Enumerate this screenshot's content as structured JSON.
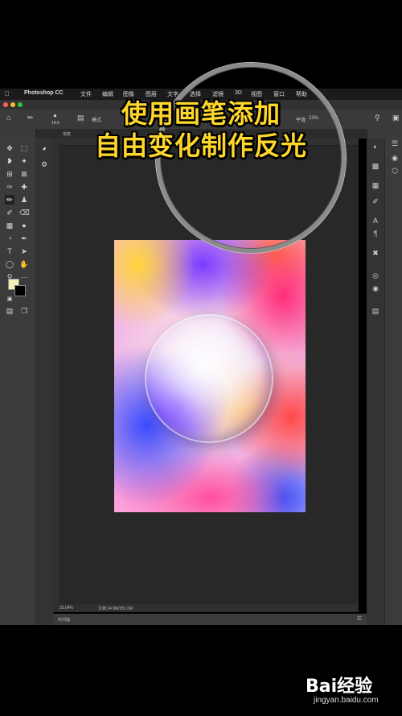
{
  "menubar": {
    "app_name": "Photoshop CC",
    "items": [
      "文件",
      "编辑",
      "图像",
      "图层",
      "文字",
      "选择",
      "滤镜",
      "3D",
      "视图",
      "窗口",
      "帮助"
    ]
  },
  "options_bar": {
    "brush_size": "19.0",
    "mode_label": "模式",
    "smoothing_label": "平滑:",
    "smoothing_value": "23%"
  },
  "doc_tab": {
    "label": "渐变"
  },
  "caption": {
    "line1": "使用画笔添加",
    "line2": "自由变化制作反光"
  },
  "status_bar": {
    "zoom": "33.04%",
    "doc_info": "文档:24.9M/351.0M"
  },
  "timeline": {
    "label": "时间轴"
  },
  "watermark": {
    "logo_text": "Bai经验",
    "url": "jingyan.baidu.com"
  },
  "colors": {
    "caption_yellow": "#ffd72a",
    "foreground_swatch": "#f3f0b9",
    "background_swatch": "#000000"
  }
}
